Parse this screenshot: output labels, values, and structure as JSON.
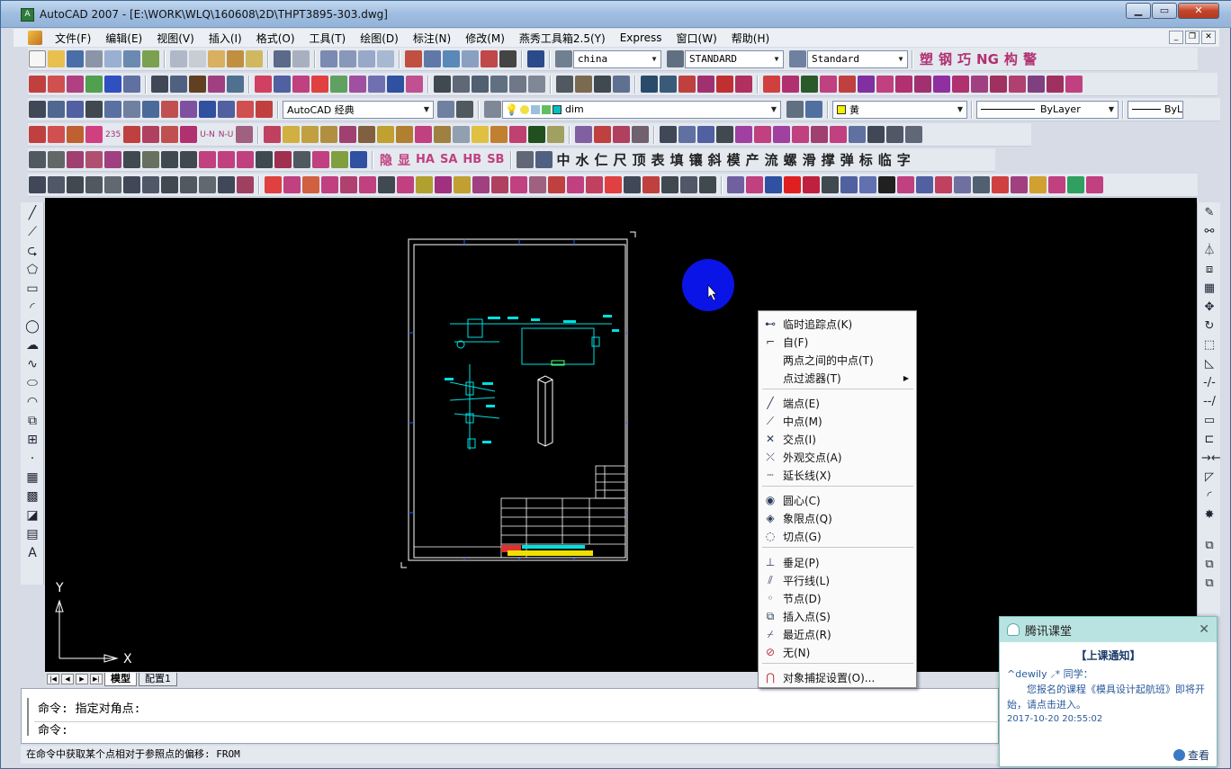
{
  "window": {
    "app_icon": "autocad-app-icon",
    "title": "AutoCAD 2007 - [E:\\WORK\\WLQ\\160608\\2D\\THPT3895-303.dwg]",
    "controls": [
      "minimize",
      "maximize",
      "close"
    ]
  },
  "menubar": {
    "items": [
      "文件(F)",
      "编辑(E)",
      "视图(V)",
      "插入(I)",
      "格式(O)",
      "工具(T)",
      "绘图(D)",
      "标注(N)",
      "修改(M)",
      "燕秀工具箱2.5(Y)",
      "Express",
      "窗口(W)",
      "帮助(H)"
    ]
  },
  "toolbars": {
    "text_style": "china",
    "dim_style": "STANDARD",
    "table_style": "Standard",
    "row2_cjk": [
      "塑",
      "钢",
      "巧",
      "NG",
      "构",
      "警"
    ],
    "workspace": "AutoCAD 经典",
    "layer": "dim",
    "color": "黄",
    "linetype": "ByLayer",
    "lineweight": "ByL",
    "row4_labels": [
      "235",
      "U-N",
      "N-U"
    ],
    "row5_labels": [
      "隐",
      "显",
      "HA",
      "SA",
      "HB",
      "SB"
    ],
    "row5_cjk": [
      "中",
      "水",
      "仁",
      "尺",
      "顶",
      "表",
      "填",
      "镶",
      "斜",
      "模",
      "产",
      "流",
      "螺",
      "滑",
      "撑",
      "弹",
      "标",
      "临",
      "字"
    ]
  },
  "canvas": {
    "background": "#000000",
    "ucs_x": "X",
    "ucs_y": "Y"
  },
  "layout_tabs": {
    "tabs": [
      "模型",
      "配置1"
    ]
  },
  "command": {
    "line1": "命令: 指定对角点:",
    "line2": "命令:"
  },
  "status_text": "在命令中获取某个点相对于参照点的偏移:  FROM",
  "context_menu": {
    "items": [
      {
        "label": "临时追踪点(K)",
        "icon": "temp-track-icon"
      },
      {
        "label": "自(F)",
        "icon": "from-icon"
      },
      {
        "label": "两点之间的中点(T)",
        "icon": ""
      },
      {
        "label": "点过滤器(T)",
        "icon": "",
        "submenu": true
      },
      {
        "label": "端点(E)",
        "icon": "endpoint-icon"
      },
      {
        "label": "中点(M)",
        "icon": "midpoint-icon"
      },
      {
        "label": "交点(I)",
        "icon": "intersection-icon"
      },
      {
        "label": "外观交点(A)",
        "icon": "apparent-intersection-icon"
      },
      {
        "label": "延长线(X)",
        "icon": "extension-icon"
      },
      {
        "label": "圆心(C)",
        "icon": "center-icon"
      },
      {
        "label": "象限点(Q)",
        "icon": "quadrant-icon"
      },
      {
        "label": "切点(G)",
        "icon": "tangent-icon"
      },
      {
        "label": "垂足(P)",
        "icon": "perpendicular-icon"
      },
      {
        "label": "平行线(L)",
        "icon": "parallel-icon"
      },
      {
        "label": "节点(D)",
        "icon": "node-icon"
      },
      {
        "label": "插入点(S)",
        "icon": "insert-icon"
      },
      {
        "label": "最近点(R)",
        "icon": "nearest-icon"
      },
      {
        "label": "无(N)",
        "icon": "none-icon"
      },
      {
        "label": "对象捕捉设置(O)...",
        "icon": "osnap-settings-icon"
      }
    ]
  },
  "notification": {
    "app": "腾讯课堂",
    "title": "【上课通知】",
    "greeting": "^dewily ⸝* 同学：",
    "body": "您报名的课程《模具设计起航班》即将开始，请点击进入。",
    "datetime": "2017-10-20 20:55:02",
    "button": "查看"
  }
}
